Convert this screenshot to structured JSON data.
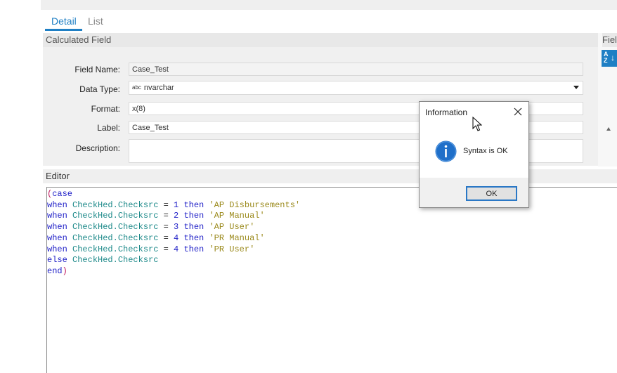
{
  "tabs": {
    "detail": "Detail",
    "list": "List"
  },
  "calculated_field": {
    "title": "Calculated Field",
    "labels": {
      "field_name": "Field Name:",
      "data_type": "Data Type:",
      "format": "Format:",
      "label": "Label:",
      "description": "Description:"
    },
    "values": {
      "field_name": "Case_Test",
      "data_type_icon": "abc",
      "data_type": "nvarchar",
      "format": "x(8)",
      "label": "Case_Test",
      "description": ""
    }
  },
  "right_panel": {
    "title": "Fiel",
    "sort_icon": "sort-az-icon"
  },
  "editor": {
    "title": "Editor",
    "code": [
      [
        {
          "t": "(",
          "c": "paren"
        },
        {
          "t": "case",
          "c": "kw"
        }
      ],
      [
        {
          "t": "when ",
          "c": "kw"
        },
        {
          "t": "CheckHed.Checksrc",
          "c": "id"
        },
        {
          "t": " = ",
          "c": "op"
        },
        {
          "t": "1",
          "c": "num"
        },
        {
          "t": " then ",
          "c": "kw"
        },
        {
          "t": "'AP Disbursements'",
          "c": "str"
        }
      ],
      [
        {
          "t": "when ",
          "c": "kw"
        },
        {
          "t": "CheckHed.Checksrc",
          "c": "id"
        },
        {
          "t": " = ",
          "c": "op"
        },
        {
          "t": "2",
          "c": "num"
        },
        {
          "t": " then ",
          "c": "kw"
        },
        {
          "t": "'AP Manual'",
          "c": "str"
        }
      ],
      [
        {
          "t": "when ",
          "c": "kw"
        },
        {
          "t": "CheckHed.Checksrc",
          "c": "id"
        },
        {
          "t": " = ",
          "c": "op"
        },
        {
          "t": "3",
          "c": "num"
        },
        {
          "t": " then ",
          "c": "kw"
        },
        {
          "t": "'AP User'",
          "c": "str"
        }
      ],
      [
        {
          "t": "when ",
          "c": "kw"
        },
        {
          "t": "CheckHed.Checksrc",
          "c": "id"
        },
        {
          "t": " = ",
          "c": "op"
        },
        {
          "t": "4",
          "c": "num"
        },
        {
          "t": " then ",
          "c": "kw"
        },
        {
          "t": "'PR Manual'",
          "c": "str"
        }
      ],
      [
        {
          "t": "when ",
          "c": "kw"
        },
        {
          "t": "CheckHed.Checksrc",
          "c": "id"
        },
        {
          "t": " = ",
          "c": "op"
        },
        {
          "t": "4",
          "c": "num"
        },
        {
          "t": " then ",
          "c": "kw"
        },
        {
          "t": "'PR User'",
          "c": "str"
        }
      ],
      [
        {
          "t": "else ",
          "c": "kw"
        },
        {
          "t": "CheckHed.Checksrc",
          "c": "id"
        }
      ],
      [
        {
          "t": "end",
          "c": "kw"
        },
        {
          "t": ")",
          "c": "paren"
        }
      ]
    ]
  },
  "dialog": {
    "title": "Information",
    "message": "Syntax is OK",
    "ok_label": "OK",
    "icon": "info-icon",
    "close_icon": "close-icon"
  },
  "colors": {
    "accent": "#1f7fc4",
    "keyword": "#2222c8",
    "identifier": "#1e8a8a",
    "string": "#9b8a1c",
    "paren": "#c0175d"
  }
}
